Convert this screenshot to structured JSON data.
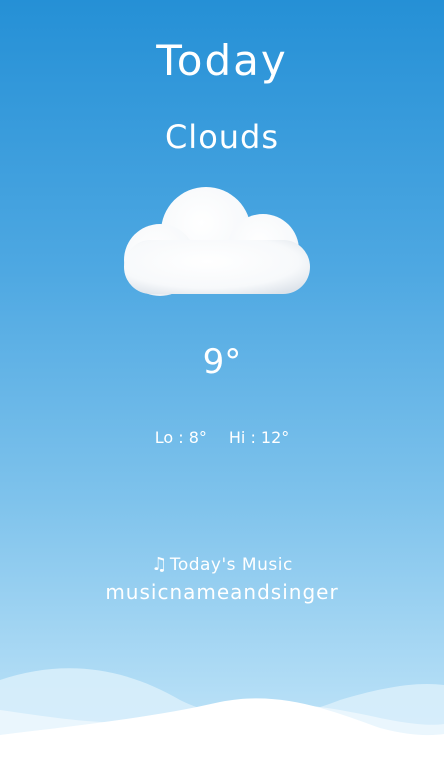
{
  "header": {
    "title": "Today"
  },
  "weather": {
    "condition": "Clouds",
    "icon": "cloud-icon",
    "temperature": "9°",
    "low": "Lo : 8°",
    "high": "Hi : 12°"
  },
  "music": {
    "icon": "music-note-icon",
    "label": "Today's Music",
    "track": "musicnameandsinger"
  },
  "colors": {
    "gradient_top": "#2590d6",
    "gradient_bottom": "#cfeafb",
    "text": "#ffffff"
  }
}
